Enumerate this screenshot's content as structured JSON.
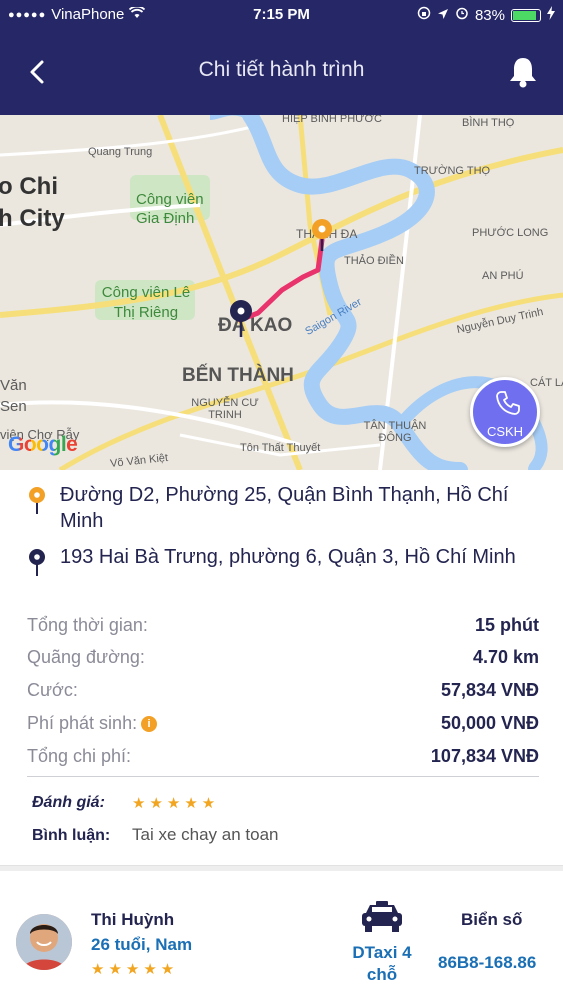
{
  "status_bar": {
    "carrier": "VinaPhone",
    "time": "7:15 PM",
    "battery": "83%",
    "battery_level": 0.83
  },
  "header": {
    "title": "Chi tiết hành trình",
    "back_icon": "chevron-left-icon",
    "bell_icon": "bell-icon"
  },
  "map": {
    "labels": {
      "hiep_binh_phuoc": "HIỆP BÌNH PHƯỚC",
      "binh_tho": "BÌNH THỌ",
      "truong_tho": "TRƯỜNG THỌ",
      "quang_trung": "Quang Trung",
      "ho_chi": "o Chi",
      "minh_city": "h City",
      "cong_vien_gia_dinh": "Công viên Gia Định",
      "thanh_da": "THANH ĐA",
      "thao_dien": "THẢO ĐIỀN",
      "phuoc_long": "PHƯỚC LONG",
      "an_phu": "AN PHÚ",
      "cong_vien_le_thi_rieng": "Công viên Lê Thị Riêng",
      "da_kao": "ĐA KAO",
      "ben_thanh": "BẾN THÀNH",
      "nguyen_cu_trinh": "NGUYỄN CƯ TRINH",
      "tan_thuan_dong": "TÂN THUẬN ĐÔNG",
      "cat_lai": "CÁT LÁI",
      "saigon_river": "Saigon River",
      "nguyen_duy_trinh": "Nguyễn Duy Trinh",
      "ton_that_thuyet": "Tôn Thất Thuyết",
      "vo_van_kiet": "Võ Văn Kiệt",
      "vien_cho_ray": "viện Chợ Rẫy",
      "van": "Văn",
      "sen": "Sen"
    },
    "google_logo": "Google",
    "cskh_label": "CSKH"
  },
  "trip": {
    "pickup": "Đường D2, Phường 25, Quận Bình Thạnh, Hồ Chí Minh",
    "dropoff": "193 Hai Bà Trưng, phường 6, Quận 3, Hồ Chí Minh",
    "summary": [
      {
        "label": "Tổng thời gian:",
        "value": "15 phút"
      },
      {
        "label": "Quãng đường:",
        "value": "4.70 km"
      },
      {
        "label": "Cước:",
        "value": "57,834 VNĐ"
      },
      {
        "label": "Phí phát sinh:",
        "value": "50,000 VNĐ"
      },
      {
        "label": "Tổng chi phí:",
        "value": "107,834 VNĐ"
      }
    ],
    "rating_label": "Đánh giá:",
    "rating": 5,
    "rating_stars": "★★★★★",
    "comment_label": "Bình luận:",
    "comment": "Tai xe chay an toan"
  },
  "driver": {
    "name": "Thi Huỳnh",
    "info": "26 tuổi, Nam",
    "rating": 5,
    "rating_stars": "★★★★★",
    "vehicle_icon": "taxi-icon",
    "vehicle": "DTaxi 4 chỗ",
    "plate_label": "Biển số",
    "plate": "86B8-168.86"
  },
  "colors": {
    "nav_bg": "#262766",
    "route": "#e8336d",
    "pickup_pin": "#f2a126",
    "dropoff_pin": "#23244f",
    "cskh_bg": "#6f6ff0",
    "link_blue": "#1a6fb5",
    "star": "#f2a520"
  }
}
